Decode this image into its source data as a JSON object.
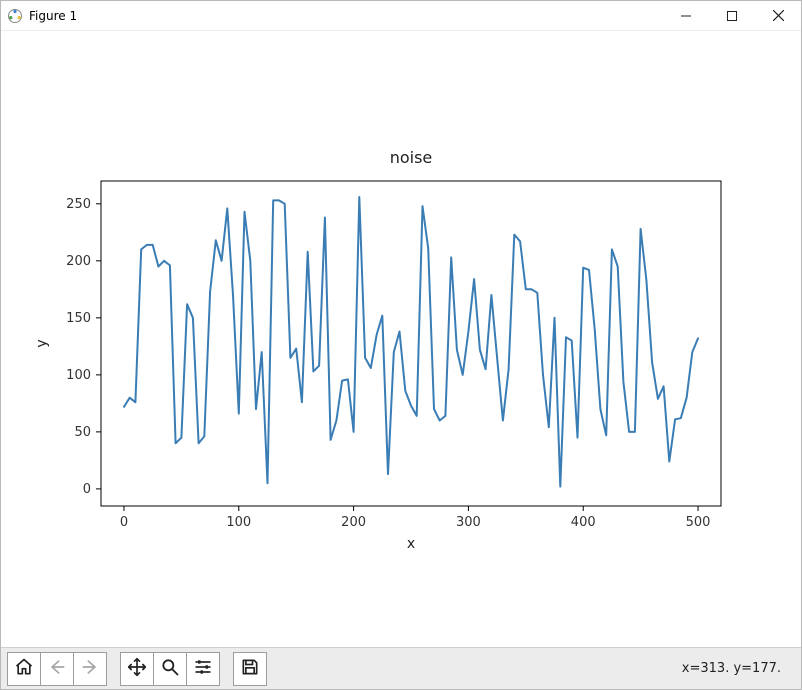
{
  "window": {
    "title": "Figure 1"
  },
  "toolbar": {
    "home_label": "Home",
    "back_label": "Back",
    "forward_label": "Forward",
    "pan_label": "Pan",
    "zoom_label": "Zoom",
    "config_label": "Configure subplots",
    "save_label": "Save"
  },
  "status": {
    "text": "x=313. y=177."
  },
  "chart_data": {
    "type": "line",
    "title": "noise",
    "xlabel": "x",
    "ylabel": "y",
    "xlim": [
      -20,
      520
    ],
    "ylim": [
      -15,
      270
    ],
    "xticks": [
      0,
      100,
      200,
      300,
      400,
      500
    ],
    "yticks": [
      0,
      50,
      100,
      150,
      200,
      250
    ],
    "series": [
      {
        "name": "noise",
        "color": "#3a7db5",
        "x": [
          0,
          5,
          10,
          15,
          20,
          25,
          30,
          35,
          40,
          45,
          50,
          55,
          60,
          65,
          70,
          75,
          80,
          85,
          90,
          95,
          100,
          105,
          110,
          115,
          120,
          125,
          130,
          135,
          140,
          145,
          150,
          155,
          160,
          165,
          170,
          175,
          180,
          185,
          190,
          195,
          200,
          205,
          210,
          215,
          220,
          225,
          230,
          235,
          240,
          245,
          250,
          255,
          260,
          265,
          270,
          275,
          280,
          285,
          290,
          295,
          300,
          305,
          310,
          315,
          320,
          325,
          330,
          335,
          340,
          345,
          350,
          355,
          360,
          365,
          370,
          375,
          380,
          385,
          390,
          395,
          400,
          405,
          410,
          415,
          420,
          425,
          430,
          435,
          440,
          445,
          450,
          455,
          460,
          465,
          470,
          475,
          480,
          485,
          490,
          495,
          500
        ],
        "y": [
          72,
          80,
          76,
          210,
          214,
          214,
          195,
          200,
          196,
          40,
          45,
          162,
          150,
          40,
          46,
          173,
          218,
          200,
          246,
          170,
          66,
          243,
          200,
          70,
          120,
          5,
          253,
          253,
          250,
          115,
          123,
          76,
          208,
          103,
          108,
          238,
          43,
          60,
          95,
          96,
          50,
          256,
          115,
          106,
          135,
          152,
          13,
          120,
          138,
          86,
          73,
          64,
          248,
          211,
          70,
          60,
          64,
          203,
          122,
          100,
          138,
          184,
          122,
          105,
          170,
          115,
          60,
          105,
          223,
          217,
          175,
          175,
          172,
          100,
          54,
          150,
          2,
          133,
          130,
          45,
          194,
          192,
          140,
          70,
          47,
          210,
          195,
          94,
          50,
          50,
          228,
          183,
          111,
          79,
          90,
          24,
          61,
          62,
          80,
          120,
          132
        ]
      }
    ]
  }
}
